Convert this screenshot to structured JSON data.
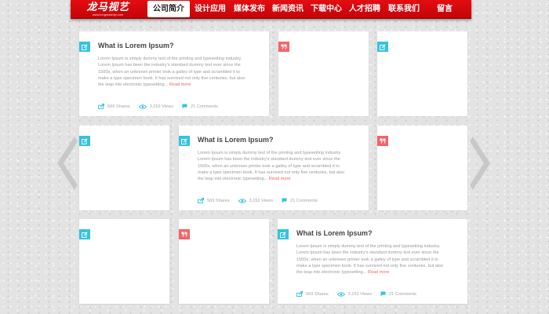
{
  "brand": {
    "name": "龙马视艺",
    "tagline": "www.longmashiyi.com"
  },
  "nav": {
    "items": [
      {
        "label": "公司简介",
        "active": true
      },
      {
        "label": "设计应用",
        "active": false
      },
      {
        "label": "媒体发布",
        "active": false
      },
      {
        "label": "新闻资讯",
        "active": false
      },
      {
        "label": "下载中心",
        "active": false
      },
      {
        "label": "人才招聘",
        "active": false
      },
      {
        "label": "联系我们",
        "active": false
      },
      {
        "label": "留言",
        "active": false
      }
    ]
  },
  "colors": {
    "nav_red": "#d9080d",
    "accent_blue": "#34c3df",
    "accent_red": "#f26569"
  },
  "post": {
    "title": "What is Lorem Ipsum?",
    "excerpt": "Lorem Ipsum is simply dummy text of the printing and typesetting industry. Lorem Ipsum has been the industry's standard dummy text ever since the 1500s, when an unknown printer took a galley of type and scrambled it to make a type specimen book. It has survived not only five centuries, but also the leap into electronic typesetting...",
    "read_more": "Read more",
    "shares": "569 Shares",
    "views": "3,152 Views",
    "comments": "21 Comments"
  },
  "cards": [
    {
      "badge": "edit-icon",
      "badge_color": "blue",
      "has_content": true
    },
    {
      "badge": "quote-icon",
      "badge_color": "red",
      "has_content": false
    },
    {
      "badge": "edit-icon",
      "badge_color": "blue",
      "has_content": false
    },
    {
      "badge": "edit-icon",
      "badge_color": "blue",
      "has_content": false
    },
    {
      "badge": "edit-icon",
      "badge_color": "blue",
      "has_content": true
    },
    {
      "badge": "quote-icon",
      "badge_color": "red",
      "has_content": false
    },
    {
      "badge": "edit-icon",
      "badge_color": "blue",
      "has_content": false
    },
    {
      "badge": "quote-icon",
      "badge_color": "red",
      "has_content": false
    },
    {
      "badge": "edit-icon",
      "badge_color": "blue",
      "has_content": true
    }
  ],
  "controls": {
    "prev": "chevron-left-icon",
    "next": "chevron-right-icon"
  }
}
